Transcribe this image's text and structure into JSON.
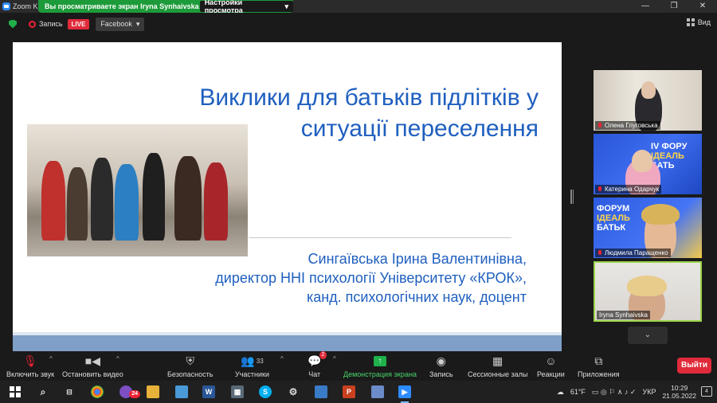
{
  "titlebar": {
    "app_title": "Zoom K",
    "share_banner": "Вы просматриваете экран Iryna Synhaivska",
    "view_options": "Настройки просмотра"
  },
  "topbar": {
    "record_label": "Запись",
    "live_label": "LIVE",
    "facebook_label": "Facebook",
    "view_label": "Вид"
  },
  "slide": {
    "title_line1": "Виклики для батьків підлітків у",
    "title_line2": "ситуації переселення",
    "author_line1": "Сингаївська Ірина Валентинівна,",
    "author_line2": "директор ННІ психології Університету «КРОК»,",
    "author_line3": "канд. психологічних наук, доцент"
  },
  "participants": [
    {
      "name": "Олена Глуговська"
    },
    {
      "name": "Катерина Одарчук"
    },
    {
      "name": "Людмила Паращенко"
    },
    {
      "name": "Iryna Synhaivska"
    }
  ],
  "tile_posters": {
    "t2_a": "IV ФОРУ",
    "t2_b": "ІДЕАЛЬ",
    "t2_c": "БАТЬ",
    "t3_a": "ФОРУМ",
    "t3_b": "ІДЕАЛЬ",
    "t3_c": "БАТЬК"
  },
  "toolbar": {
    "mute": "Включить звук",
    "video": "Остановить видео",
    "security": "Безопасность",
    "participants": "Участники",
    "participants_count": "33",
    "chat": "Чат",
    "chat_badge": "2",
    "share": "Демонстрация экрана",
    "record": "Запись",
    "breakout": "Сессионные залы",
    "reactions": "Реакции",
    "apps": "Приложения",
    "end": "Выйти"
  },
  "taskbar": {
    "weather": "61°F",
    "lang": "УКР",
    "time": "10:29",
    "date": "21.05.2022",
    "notifications": "4",
    "viber_badge": "24"
  },
  "colors": {
    "accent_green": "#1d9b3a",
    "slide_blue": "#1f5fbf",
    "live_red": "#e02b3a",
    "active_speaker": "#9bd44a"
  }
}
